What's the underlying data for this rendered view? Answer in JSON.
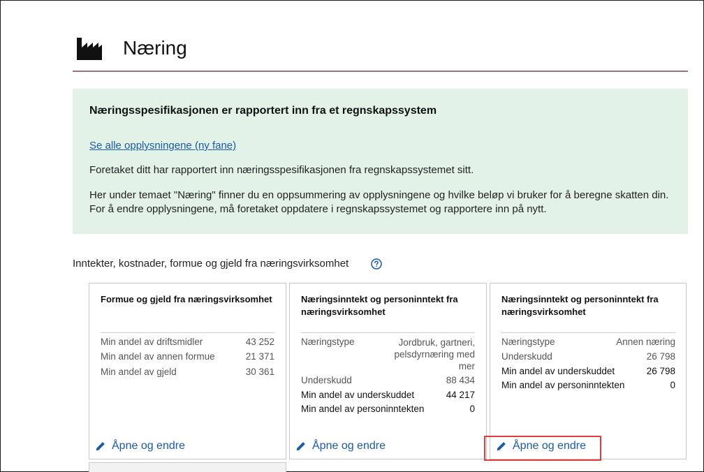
{
  "page": {
    "title": "Næring",
    "icon": "factory-icon"
  },
  "info": {
    "heading": "Næringsspesifikasjonen er rapportert inn fra et regnskapssystem",
    "link": "Se alle opplysningene (ny fane)",
    "p1": "Foretaket ditt har rapportert inn næringsspesifikasjonen fra regnskapssystemet sitt.",
    "p2": "Her under temaet \"Næring\" finner du en oppsummering av opplysningene og hvilke beløp vi bruker for å beregne skatten din. For å endre opplysningene, må foretaket oppdatere i regnskapssystemet og rapportere inn på nytt."
  },
  "section": {
    "label": "Inntekter, kostnader, formue og gjeld fra næringsvirksomhet",
    "help_icon": "question-circle-icon"
  },
  "cards": [
    {
      "title": "Formue og gjeld fra næringsvirksomhet",
      "rows": [
        {
          "label": "Min andel av driftsmidler",
          "value": "43 252"
        },
        {
          "label": "Min andel av annen formue",
          "value": "21 371"
        },
        {
          "label": "Min andel av gjeld",
          "value": "30 361"
        }
      ],
      "edit_label": "Åpne og endre"
    },
    {
      "title": "Næringsinntekt og personinntekt fra næringsvirksomhet",
      "rows": [
        {
          "label": "Næringstype",
          "value": "Jordbruk, gartneri, pelsdyrnæring med mer"
        },
        {
          "label": "Underskudd",
          "value": "88 434"
        },
        {
          "label": "Min andel av underskuddet",
          "value": "44 217"
        },
        {
          "label": "Min andel av personinntekten",
          "value": "0"
        }
      ],
      "edit_label": "Åpne og endre"
    },
    {
      "title": "Næringsinntekt og personinntekt fra næringsvirksomhet",
      "rows": [
        {
          "label": "Næringstype",
          "value": "Annen næring"
        },
        {
          "label": "Underskudd",
          "value": "26 798"
        },
        {
          "label": "Min andel av underskuddet",
          "value": "26 798"
        },
        {
          "label": "Min andel av personinntekten",
          "value": "0"
        }
      ],
      "edit_label": "Åpne og endre"
    }
  ],
  "colors": {
    "accent_link": "#1a5aa8",
    "info_bg": "#e2f2e6",
    "highlight": "#e23b3b"
  }
}
